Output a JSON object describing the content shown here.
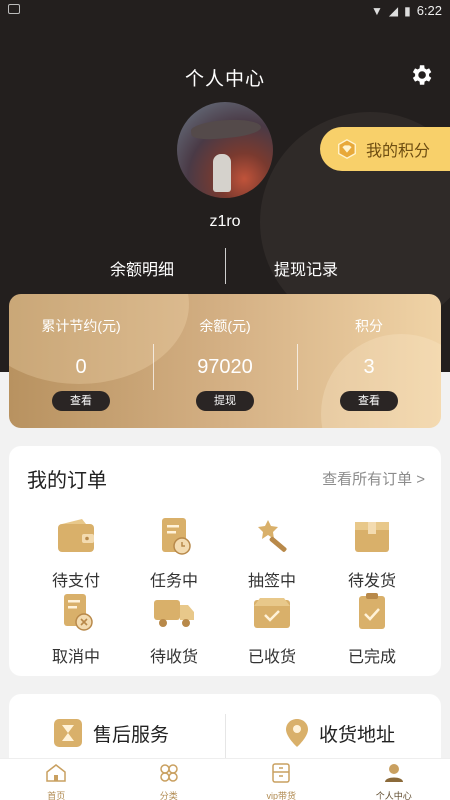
{
  "status_bar": {
    "time": "6:22"
  },
  "header": {
    "title": "个人中心",
    "username": "z1ro",
    "points_pill": "我的积分",
    "links": [
      "余额明细",
      "提现记录"
    ]
  },
  "stats": [
    {
      "label": "累计节约(元)",
      "value": "0",
      "button": "查看"
    },
    {
      "label": "余额(元)",
      "value": "97020",
      "button": "提现"
    },
    {
      "label": "积分",
      "value": "3",
      "button": "查看"
    }
  ],
  "orders": {
    "title": "我的订单",
    "view_all": "查看所有订单 >",
    "items": [
      "待支付",
      "任务中",
      "抽签中",
      "待发货",
      "取消中",
      "待收货",
      "已收货",
      "已完成"
    ]
  },
  "services": {
    "after_sales": "售后服务",
    "address": "收货地址"
  },
  "tabs": [
    "首页",
    "分类",
    "vip带货",
    "个人中心"
  ],
  "colors": {
    "dark": "#231f1e",
    "gold": "#d4b084",
    "pill": "#f8d06a",
    "icon_gold": "#d4a95c"
  }
}
